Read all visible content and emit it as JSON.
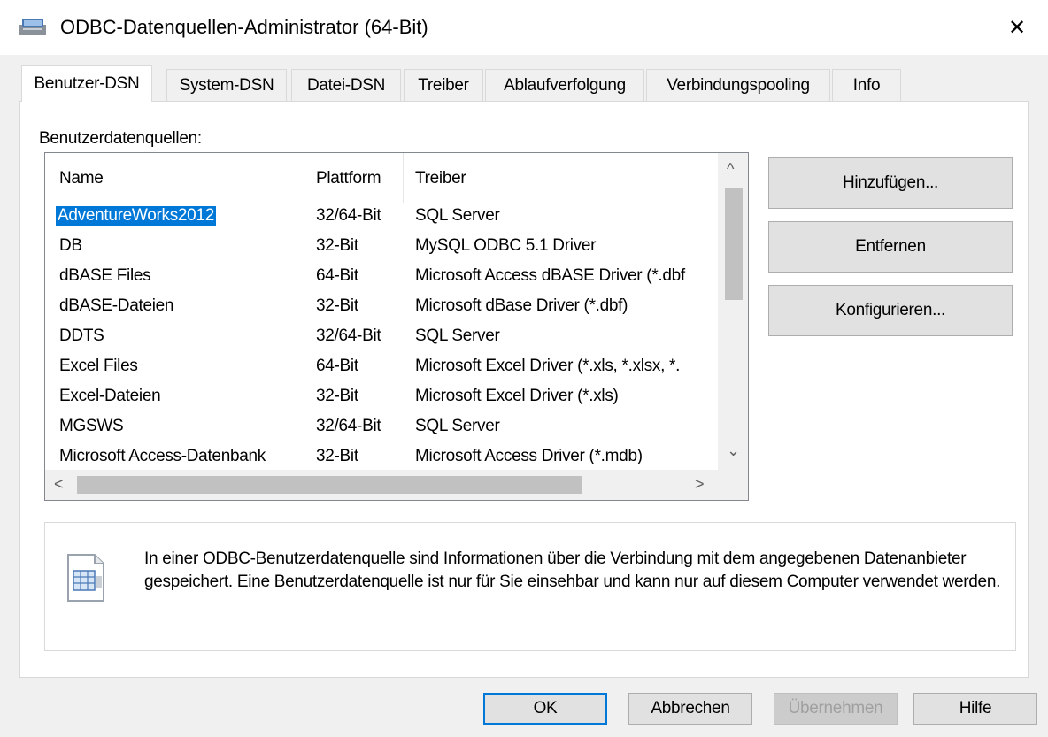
{
  "window": {
    "title": "ODBC-Datenquellen-Administrator (64-Bit)",
    "close_glyph": "✕"
  },
  "tabs": [
    {
      "label": "Benutzer-DSN",
      "active": true
    },
    {
      "label": "System-DSN"
    },
    {
      "label": "Datei-DSN"
    },
    {
      "label": "Treiber"
    },
    {
      "label": "Ablaufverfolgung"
    },
    {
      "label": "Verbindungspooling"
    },
    {
      "label": "Info"
    }
  ],
  "group_label": "Benutzerdatenquellen:",
  "list": {
    "columns": [
      "Name",
      "Plattform",
      "Treiber"
    ],
    "rows": [
      {
        "name": "AdventureWorks2012",
        "platform": "32/64-Bit",
        "driver": "SQL Server",
        "selected": true
      },
      {
        "name": "DB",
        "platform": "32-Bit",
        "driver": "MySQL ODBC 5.1 Driver"
      },
      {
        "name": "dBASE Files",
        "platform": "64-Bit",
        "driver": "Microsoft Access dBASE Driver (*.dbf"
      },
      {
        "name": "dBASE-Dateien",
        "platform": "32-Bit",
        "driver": "Microsoft dBase Driver (*.dbf)"
      },
      {
        "name": "DDTS",
        "platform": "32/64-Bit",
        "driver": "SQL Server"
      },
      {
        "name": "Excel Files",
        "platform": "64-Bit",
        "driver": "Microsoft Excel Driver (*.xls, *.xlsx, *."
      },
      {
        "name": "Excel-Dateien",
        "platform": "32-Bit",
        "driver": "Microsoft Excel Driver (*.xls)"
      },
      {
        "name": "MGSWS",
        "platform": "32/64-Bit",
        "driver": "SQL Server"
      },
      {
        "name": "Microsoft Access-Datenbank",
        "platform": "32-Bit",
        "driver": "Microsoft Access Driver (*.mdb)"
      }
    ],
    "scroll_up": "^",
    "scroll_down": "⌄",
    "scroll_left": "<",
    "scroll_right": ">"
  },
  "side_buttons": {
    "add": "Hinzufügen...",
    "remove": "Entfernen",
    "configure": "Konfigurieren..."
  },
  "info": {
    "icon": "data-source-icon",
    "text": "In einer ODBC-Benutzerdatenquelle sind Informationen über die Verbindung mit dem angegebenen Datenanbieter gespeichert. Eine Benutzerdatenquelle ist nur für Sie einsehbar und kann nur auf diesem Computer verwendet werden."
  },
  "footer": {
    "ok": "OK",
    "cancel": "Abbrechen",
    "apply": "Übernehmen",
    "help": "Hilfe"
  },
  "colors": {
    "selection": "#0078d7",
    "default_button_border": "#0078d7"
  }
}
